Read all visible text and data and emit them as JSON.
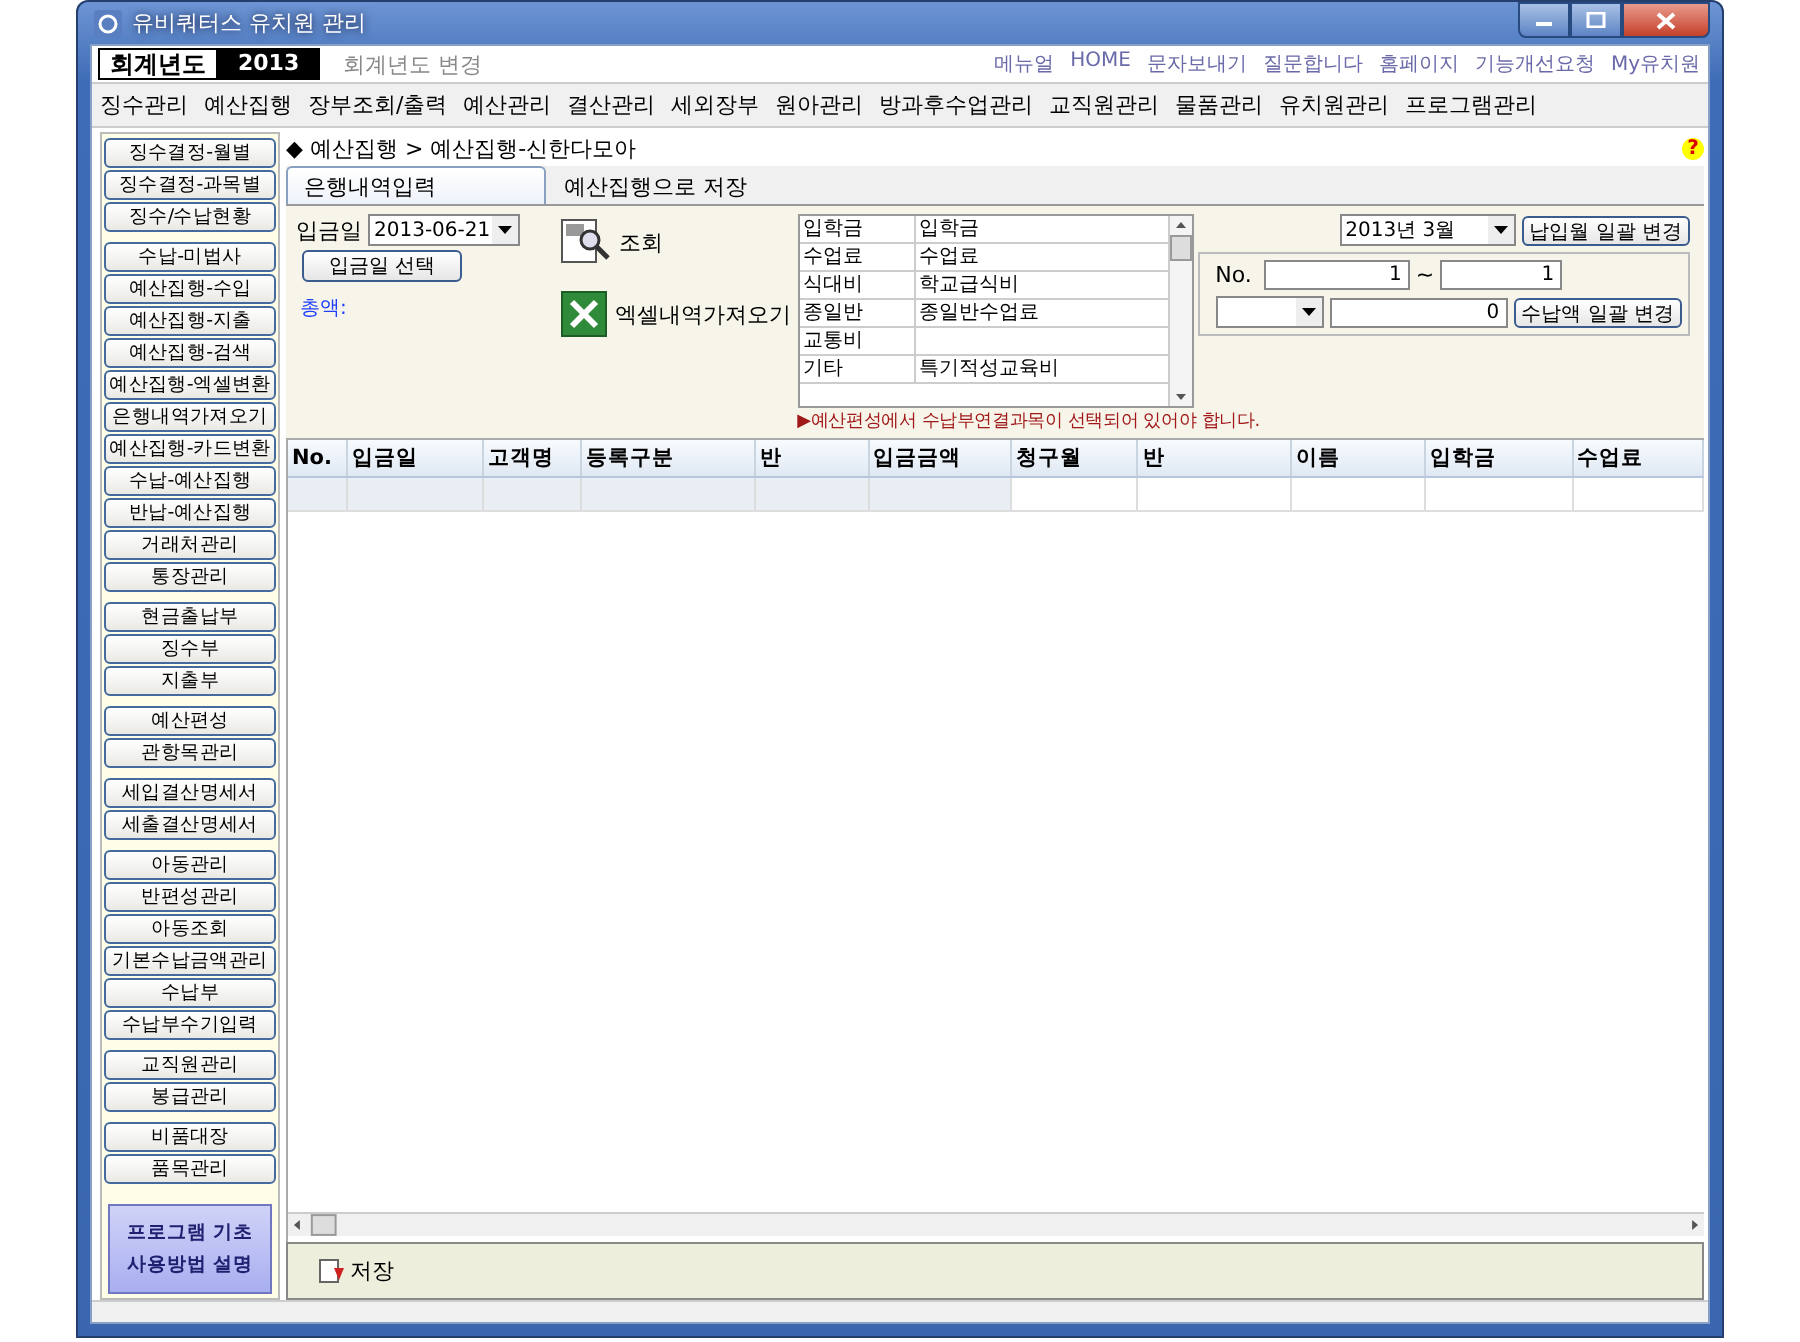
{
  "window": {
    "title": "유비쿼터스 유치원 관리"
  },
  "fiscal_year": {
    "label": "회계년도",
    "value": "2013",
    "change_link": "회계년도 변경"
  },
  "top_links": [
    "메뉴얼",
    "HOME",
    "문자보내기",
    "질문합니다",
    "홈페이지",
    "기능개선요청",
    "My유치원"
  ],
  "menu": [
    "징수관리",
    "예산집행",
    "장부조회/출력",
    "예산관리",
    "결산관리",
    "세외장부",
    "원아관리",
    "방과후수업관리",
    "교직원관리",
    "물품관리",
    "유치원관리",
    "프로그램관리"
  ],
  "sidebar": {
    "groups": [
      [
        "징수결정-월별",
        "징수결정-과목별",
        "징수/수납현황"
      ],
      [
        "수납-미법사",
        "예산집행-수입",
        "예산집행-지출",
        "예산집행-검색",
        "예산집행-엑셀변환",
        "은행내역가져오기",
        "예산집행-카드변환",
        "수납-예산집행",
        "반납-예산집행",
        "거래처관리",
        "통장관리"
      ],
      [
        "현금출납부",
        "징수부",
        "지출부"
      ],
      [
        "예산편성",
        "관항목관리"
      ],
      [
        "세입결산명세서",
        "세출결산명세서"
      ],
      [
        "아동관리",
        "반편성관리",
        "아동조회",
        "기본수납금액관리",
        "수납부",
        "수납부수기입력"
      ],
      [
        "교직원관리",
        "봉급관리"
      ],
      [
        "비품대장",
        "품목관리"
      ]
    ],
    "help_button": [
      "프로그램 기초",
      "사용방법 설명"
    ]
  },
  "breadcrumb": "◆ 예산집행 > 예산집행-신한다모아",
  "help_icon": "?",
  "tabs": [
    {
      "label": "은행내역입력",
      "selected": true
    },
    {
      "label": "예산집행으로 저장",
      "selected": false
    }
  ],
  "form": {
    "date_label": "입금일",
    "date_value": "2013-06-21",
    "date_button": "입금일 선택",
    "total_label": "총액:",
    "query_button": "조회",
    "excel_button": "엑셀내역가져오기",
    "mapping": [
      {
        "item": "입학금",
        "subject": "입학금"
      },
      {
        "item": "수업료",
        "subject": "수업료"
      },
      {
        "item": "식대비",
        "subject": "학교급식비"
      },
      {
        "item": "종일반",
        "subject": "종일반수업료"
      },
      {
        "item": "교통비"
      },
      {
        "item": "기타",
        "subject": "특기적성교육비"
      }
    ],
    "warning": "▶예산편성에서 수납부연결과목이 선택되어 있어야 합니다.",
    "month_value": "2013년 3월",
    "month_button": "납입월 일괄 변경",
    "no_label": "No.",
    "no_from": "1",
    "tilde": "~",
    "no_to": "1",
    "amount_value": "0",
    "amount_button": "수납액 일괄 변경"
  },
  "table": {
    "columns": [
      "No.",
      "입금일",
      "고객명",
      "등록구분",
      "반",
      "입금금액",
      "청구월",
      "반",
      "이름",
      "입학금",
      "수업료"
    ]
  },
  "save_button": "저장"
}
